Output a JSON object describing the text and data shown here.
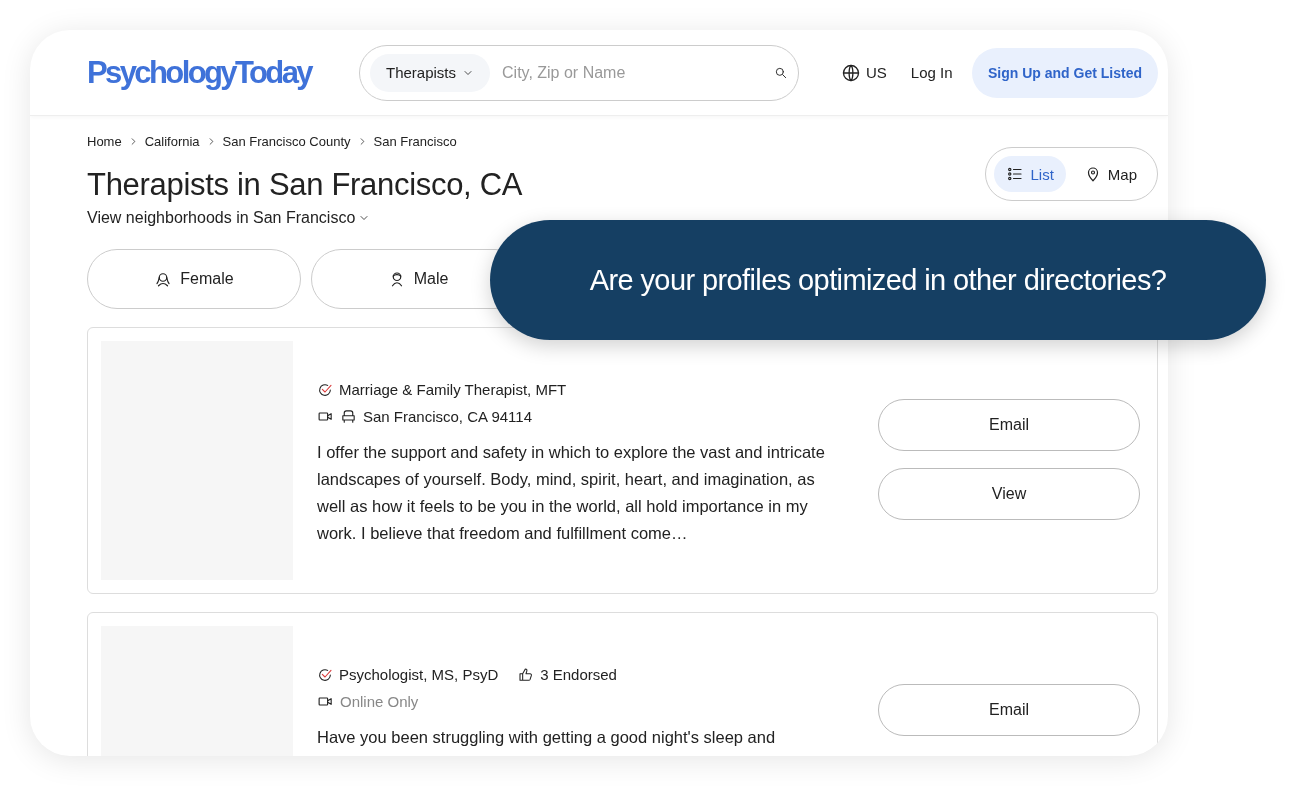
{
  "header": {
    "logo": "PsychologyToday",
    "search": {
      "category": "Therapists",
      "placeholder": "City, Zip or Name"
    },
    "region": "US",
    "login": "Log In",
    "signup": "Sign Up and Get Listed"
  },
  "breadcrumbs": [
    "Home",
    "California",
    "San Francisco County",
    "San Francisco"
  ],
  "title": "Therapists in San Francisco, CA",
  "neighborhoods": "View neighborhoods in San Francisco",
  "view_toggle": [
    {
      "label": "List",
      "kind": "list",
      "selected": true
    },
    {
      "label": "Map",
      "kind": "map",
      "selected": false
    }
  ],
  "filters": [
    {
      "label": "Female",
      "kind": "female"
    },
    {
      "label": "Male",
      "kind": "male"
    }
  ],
  "profiles": [
    {
      "credential": "Marriage & Family Therapist, MFT",
      "location": "San Francisco, CA 94114",
      "in_person": true,
      "bio": "I offer the support and safety in which to explore the vast and intricate landscapes of yourself. Body, mind, spirit, heart, and imagination, as well as how it feels to be you in the world, all hold importance in my work. I believe that freedom and fulfillment come…",
      "buttons": [
        "Email",
        "View"
      ]
    },
    {
      "credential": "Psychologist, MS, PsyD",
      "endorsed": "3 Endorsed",
      "location": "Online Only",
      "in_person": false,
      "bio": "Have you been struggling with getting a good night's sleep and",
      "buttons": [
        "Email"
      ]
    }
  ],
  "banner": "Are your profiles optimized in other directories?"
}
